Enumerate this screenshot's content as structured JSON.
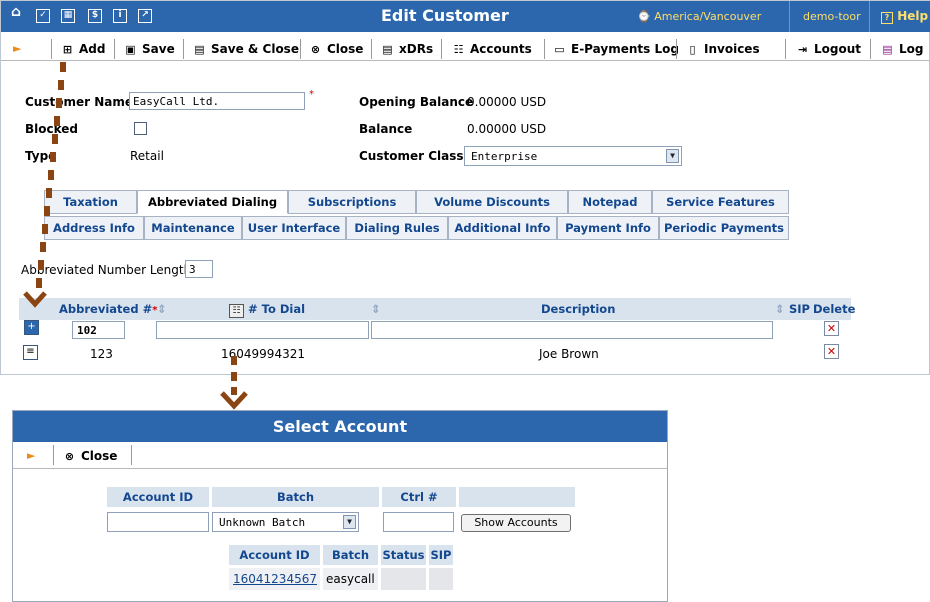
{
  "titlebar": {
    "title": "Edit Customer",
    "timezone": "America/Vancouver",
    "user": "demo-toor",
    "help": "Help"
  },
  "toolbar": {
    "add": "Add",
    "save": "Save",
    "save_close": "Save & Close",
    "close": "Close",
    "xdrs": "xDRs",
    "accounts": "Accounts",
    "epayments": "E-Payments Log",
    "invoices": "Invoices",
    "logout": "Logout",
    "log": "Log"
  },
  "form": {
    "customer_name_label": "Customer Name",
    "customer_name_value": "EasyCall Ltd.",
    "blocked_label": "Blocked",
    "type_label": "Type",
    "type_value": "Retail",
    "opening_balance_label": "Opening Balance",
    "opening_balance_value": "0.00000 USD",
    "balance_label": "Balance",
    "balance_value": "0.00000 USD",
    "customer_class_label": "Customer Class",
    "customer_class_value": "Enterprise"
  },
  "tabs_row1": [
    "Taxation",
    "Abbreviated Dialing",
    "Subscriptions",
    "Volume Discounts",
    "Notepad",
    "Service Features"
  ],
  "tabs_row2": [
    "Address Info",
    "Maintenance",
    "User Interface",
    "Dialing Rules",
    "Additional Info",
    "Payment Info",
    "Periodic Payments"
  ],
  "abbrev": {
    "length_label": "Abbreviated Number Length",
    "length_value": "3",
    "columns": {
      "abbrev": "Abbreviated #",
      "to_dial": "# To Dial",
      "description": "Description",
      "sip": "SIP",
      "delete": "Delete"
    },
    "new_row_value": "102",
    "rows": [
      {
        "abbrev": "123",
        "to_dial": "16049994321",
        "description": "Joe Brown"
      }
    ]
  },
  "select_account": {
    "title": "Select Account",
    "close": "Close",
    "search_headers": [
      "Account ID",
      "Batch",
      "Ctrl #"
    ],
    "batch_value": "Unknown Batch",
    "show_accounts": "Show Accounts",
    "result_headers": [
      "Account ID",
      "Batch",
      "Status",
      "SIP"
    ],
    "results": [
      {
        "account_id": "16041234567",
        "batch": "easycall",
        "status": "",
        "sip": ""
      }
    ]
  },
  "colors": {
    "header_blue": "#2c67ad",
    "link_blue": "#13478e",
    "dashed_arrow": "#8b4513"
  }
}
